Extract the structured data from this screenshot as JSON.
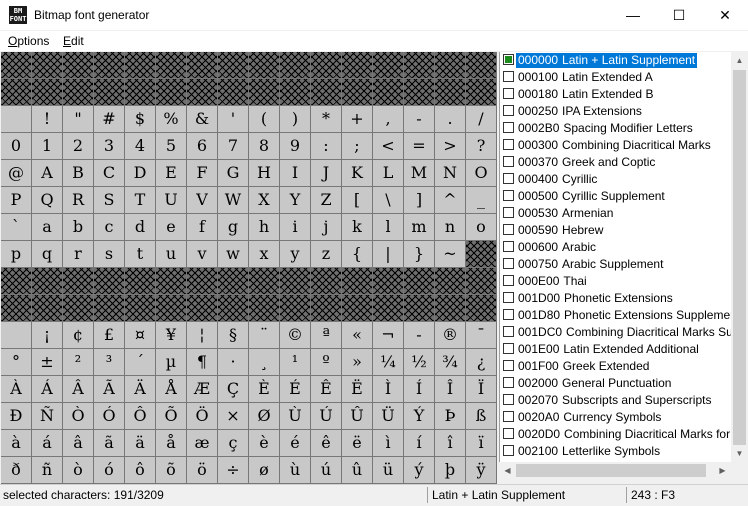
{
  "window": {
    "title": "Bitmap font generator",
    "icon_text": "BM FONT",
    "minimize": "—",
    "maximize": "☐",
    "close": "✕"
  },
  "menu": [
    {
      "label": "Options",
      "mnemonic": "O"
    },
    {
      "label": "Edit",
      "mnemonic": "E"
    }
  ],
  "char_grid": {
    "columns": 16,
    "rows": [
      [
        "",
        "",
        "",
        "",
        "",
        "",
        "",
        "",
        "",
        "",
        "",
        "",
        "",
        "",
        "",
        ""
      ],
      [
        "",
        "",
        "",
        "",
        "",
        "",
        "",
        "",
        "",
        "",
        "",
        "",
        "",
        "",
        "",
        ""
      ],
      [
        " ",
        "!",
        "\"",
        "#",
        "$",
        "%",
        "&",
        "'",
        "(",
        ")",
        "*",
        "+",
        ",",
        "-",
        ".",
        "/"
      ],
      [
        "0",
        "1",
        "2",
        "3",
        "4",
        "5",
        "6",
        "7",
        "8",
        "9",
        ":",
        ";",
        "<",
        "=",
        ">",
        "?"
      ],
      [
        "@",
        "A",
        "B",
        "C",
        "D",
        "E",
        "F",
        "G",
        "H",
        "I",
        "J",
        "K",
        "L",
        "M",
        "N",
        "O"
      ],
      [
        "P",
        "Q",
        "R",
        "S",
        "T",
        "U",
        "V",
        "W",
        "X",
        "Y",
        "Z",
        "[",
        "\\",
        "]",
        "^",
        "_"
      ],
      [
        "`",
        "a",
        "b",
        "c",
        "d",
        "e",
        "f",
        "g",
        "h",
        "i",
        "j",
        "k",
        "l",
        "m",
        "n",
        "o"
      ],
      [
        "p",
        "q",
        "r",
        "s",
        "t",
        "u",
        "v",
        "w",
        "x",
        "y",
        "z",
        "{",
        "|",
        "}",
        "~",
        ""
      ],
      [
        "",
        "",
        "",
        "",
        "",
        "",
        "",
        "",
        "",
        "",
        "",
        "",
        "",
        "",
        "",
        ""
      ],
      [
        "",
        "",
        "",
        "",
        "",
        "",
        "",
        "",
        "",
        "",
        "",
        "",
        "",
        "",
        "",
        ""
      ],
      [
        " ",
        "¡",
        "¢",
        "£",
        "¤",
        "¥",
        "¦",
        "§",
        "¨",
        "©",
        "ª",
        "«",
        "¬",
        "-",
        "®",
        "¯"
      ],
      [
        "°",
        "±",
        "²",
        "³",
        "´",
        "µ",
        "¶",
        "·",
        "¸",
        "¹",
        "º",
        "»",
        "¼",
        "½",
        "¾",
        "¿"
      ],
      [
        "À",
        "Á",
        "Â",
        "Ã",
        "Ä",
        "Å",
        "Æ",
        "Ç",
        "È",
        "É",
        "Ê",
        "Ë",
        "Ì",
        "Í",
        "Î",
        "Ï"
      ],
      [
        "Ð",
        "Ñ",
        "Ò",
        "Ó",
        "Ô",
        "Õ",
        "Ö",
        "×",
        "Ø",
        "Ù",
        "Ú",
        "Û",
        "Ü",
        "Ý",
        "Þ",
        "ß"
      ],
      [
        "à",
        "á",
        "â",
        "ã",
        "ä",
        "å",
        "æ",
        "ç",
        "è",
        "é",
        "ê",
        "ë",
        "ì",
        "í",
        "î",
        "ï"
      ],
      [
        "ð",
        "ñ",
        "ò",
        "ó",
        "ô",
        "õ",
        "ö",
        "÷",
        "ø",
        "ù",
        "ú",
        "û",
        "ü",
        "ý",
        "þ",
        "ÿ"
      ]
    ],
    "unavailable": [
      [
        0,
        0
      ],
      [
        0,
        1
      ],
      [
        0,
        2
      ],
      [
        0,
        3
      ],
      [
        0,
        4
      ],
      [
        0,
        5
      ],
      [
        0,
        6
      ],
      [
        0,
        7
      ],
      [
        0,
        8
      ],
      [
        0,
        9
      ],
      [
        0,
        10
      ],
      [
        0,
        11
      ],
      [
        0,
        12
      ],
      [
        0,
        13
      ],
      [
        0,
        14
      ],
      [
        0,
        15
      ],
      [
        1,
        0
      ],
      [
        1,
        1
      ],
      [
        1,
        2
      ],
      [
        1,
        3
      ],
      [
        1,
        4
      ],
      [
        1,
        5
      ],
      [
        1,
        6
      ],
      [
        1,
        7
      ],
      [
        1,
        8
      ],
      [
        1,
        9
      ],
      [
        1,
        10
      ],
      [
        1,
        11
      ],
      [
        1,
        12
      ],
      [
        1,
        13
      ],
      [
        1,
        14
      ],
      [
        1,
        15
      ],
      [
        7,
        15
      ],
      [
        8,
        0
      ],
      [
        8,
        1
      ],
      [
        8,
        2
      ],
      [
        8,
        3
      ],
      [
        8,
        4
      ],
      [
        8,
        5
      ],
      [
        8,
        6
      ],
      [
        8,
        7
      ],
      [
        8,
        8
      ],
      [
        8,
        9
      ],
      [
        8,
        10
      ],
      [
        8,
        11
      ],
      [
        8,
        12
      ],
      [
        8,
        13
      ],
      [
        8,
        14
      ],
      [
        8,
        15
      ],
      [
        9,
        0
      ],
      [
        9,
        1
      ],
      [
        9,
        2
      ],
      [
        9,
        3
      ],
      [
        9,
        4
      ],
      [
        9,
        5
      ],
      [
        9,
        6
      ],
      [
        9,
        7
      ],
      [
        9,
        8
      ],
      [
        9,
        9
      ],
      [
        9,
        10
      ],
      [
        9,
        11
      ],
      [
        9,
        12
      ],
      [
        9,
        13
      ],
      [
        9,
        14
      ],
      [
        9,
        15
      ]
    ]
  },
  "ranges": [
    {
      "code": "000000",
      "name": "Latin + Latin Supplement",
      "checked": true,
      "selected": true
    },
    {
      "code": "000100",
      "name": "Latin Extended A",
      "checked": false
    },
    {
      "code": "000180",
      "name": "Latin Extended B",
      "checked": false
    },
    {
      "code": "000250",
      "name": "IPA Extensions",
      "checked": false
    },
    {
      "code": "0002B0",
      "name": "Spacing Modifier Letters",
      "checked": false
    },
    {
      "code": "000300",
      "name": "Combining Diacritical Marks",
      "checked": false
    },
    {
      "code": "000370",
      "name": "Greek and Coptic",
      "checked": false
    },
    {
      "code": "000400",
      "name": "Cyrillic",
      "checked": false
    },
    {
      "code": "000500",
      "name": "Cyrillic Supplement",
      "checked": false
    },
    {
      "code": "000530",
      "name": "Armenian",
      "checked": false
    },
    {
      "code": "000590",
      "name": "Hebrew",
      "checked": false
    },
    {
      "code": "000600",
      "name": "Arabic",
      "checked": false
    },
    {
      "code": "000750",
      "name": "Arabic Supplement",
      "checked": false
    },
    {
      "code": "000E00",
      "name": "Thai",
      "checked": false
    },
    {
      "code": "001D00",
      "name": "Phonetic Extensions",
      "checked": false
    },
    {
      "code": "001D80",
      "name": "Phonetic Extensions Supplement",
      "checked": false
    },
    {
      "code": "001DC0",
      "name": "Combining Diacritical Marks Supplement",
      "checked": false
    },
    {
      "code": "001E00",
      "name": "Latin Extended Additional",
      "checked": false
    },
    {
      "code": "001F00",
      "name": "Greek Extended",
      "checked": false
    },
    {
      "code": "002000",
      "name": "General Punctuation",
      "checked": false
    },
    {
      "code": "002070",
      "name": "Subscripts and Superscripts",
      "checked": false
    },
    {
      "code": "0020A0",
      "name": "Currency Symbols",
      "checked": false
    },
    {
      "code": "0020D0",
      "name": "Combining Diacritical Marks for Symbols",
      "checked": false
    },
    {
      "code": "002100",
      "name": "Letterlike Symbols",
      "checked": false
    }
  ],
  "status": {
    "selected": "selected characters: 191/3209",
    "range": "Latin + Latin Supplement",
    "position": "243 : F3"
  },
  "colors": {
    "selection": "#0078d7",
    "checkbox_mark": "#1c8c1c"
  },
  "icons": {
    "scroll_up": "▲",
    "scroll_down": "▼",
    "scroll_left": "◀",
    "scroll_right": "▶"
  }
}
